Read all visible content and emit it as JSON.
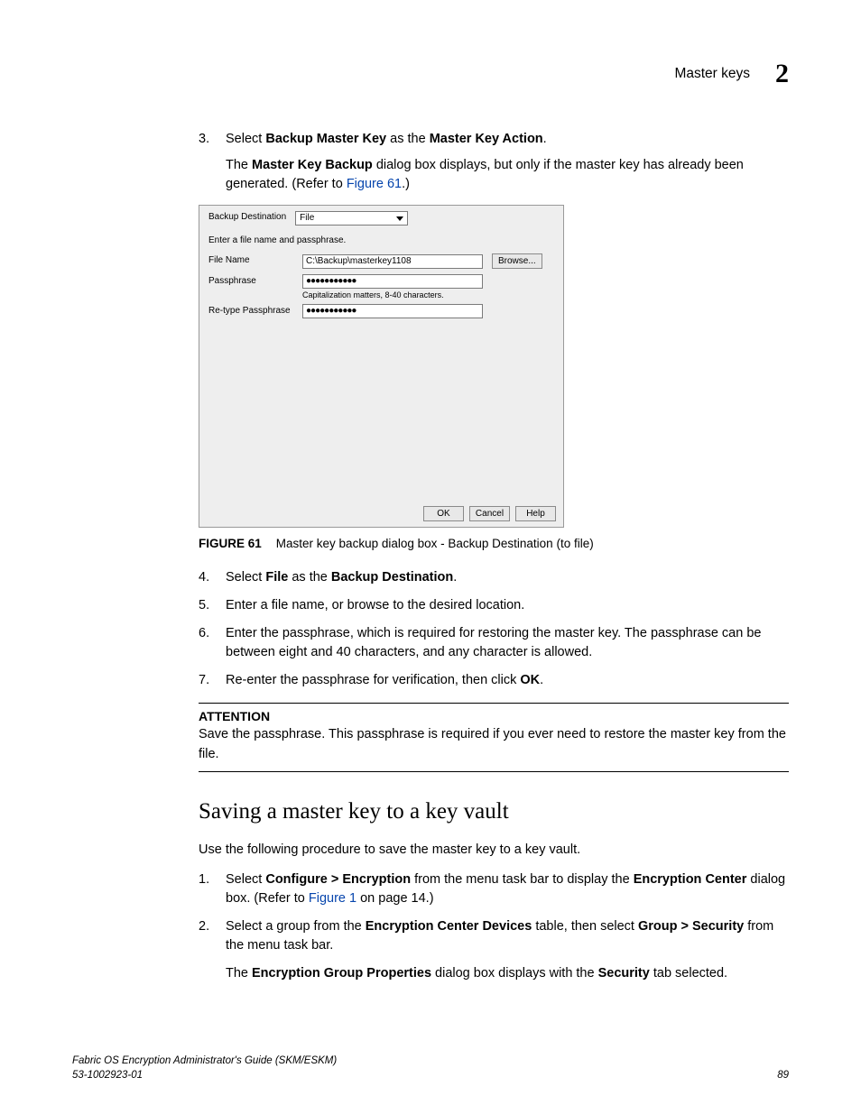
{
  "header": {
    "title": "Master keys",
    "chapter": "2"
  },
  "step3": {
    "num": "3.",
    "line1_a": "Select ",
    "line1_b": "Backup Master Key",
    "line1_c": " as the ",
    "line1_d": "Master Key Action",
    "line1_e": ".",
    "line2_a": "The ",
    "line2_b": "Master Key Backup",
    "line2_c": " dialog box displays, but only if the master key has already been generated. (Refer to ",
    "line2_link": "Figure 61",
    "line2_d": ".)"
  },
  "dialog": {
    "dest_label": "Backup Destination",
    "dest_value": "File",
    "prompt": "Enter a file name and passphrase.",
    "file_label": "File Name",
    "file_value": "C:\\Backup\\masterkey1108",
    "browse": "Browse...",
    "pass_label": "Passphrase",
    "pass_value": "●●●●●●●●●●●",
    "hint": "Capitalization matters, 8-40 characters.",
    "retype_label": "Re-type Passphrase",
    "retype_value": "●●●●●●●●●●●",
    "ok": "OK",
    "cancel": "Cancel",
    "help": "Help"
  },
  "figcap": {
    "num": "FIGURE 61",
    "text": "Master key backup dialog box - Backup Destination (to file)"
  },
  "step4": {
    "num": "4.",
    "a": "Select ",
    "b": "File",
    "c": " as the ",
    "d": "Backup Destination",
    "e": "."
  },
  "step5": {
    "num": "5.",
    "text": "Enter a file name, or browse to the desired location."
  },
  "step6": {
    "num": "6.",
    "text": "Enter the passphrase, which is required for restoring the master key. The passphrase can be between eight and 40 characters, and any character is allowed."
  },
  "step7": {
    "num": "7.",
    "a": "Re-enter the passphrase for verification, then click ",
    "b": "OK",
    "c": "."
  },
  "attention": {
    "title": "ATTENTION",
    "text": "Save the passphrase. This passphrase is required if you ever need to restore the master key from the file."
  },
  "section2": {
    "title": "Saving a master key to a key vault",
    "intro": "Use the following procedure to save the master key to a key vault.",
    "s1": {
      "num": "1.",
      "a": "Select ",
      "b": "Configure > Encryption",
      "c": " from the menu task bar to display the ",
      "d": "Encryption Center",
      "e": " dialog box. (Refer to ",
      "link": "Figure 1",
      "f": " on page 14.)"
    },
    "s2": {
      "num": "2.",
      "a": "Select a group from the ",
      "b": "Encryption Center Devices",
      "c": " table, then select ",
      "d": "Group > Security",
      "e": " from the menu task bar.",
      "p2a": "The ",
      "p2b": "Encryption Group Properties",
      "p2c": " dialog box displays with the ",
      "p2d": "Security",
      "p2e": " tab selected."
    }
  },
  "footer": {
    "left1": "Fabric OS Encryption Administrator's Guide (SKM/ESKM)",
    "left2": "53-1002923-01",
    "page": "89"
  }
}
